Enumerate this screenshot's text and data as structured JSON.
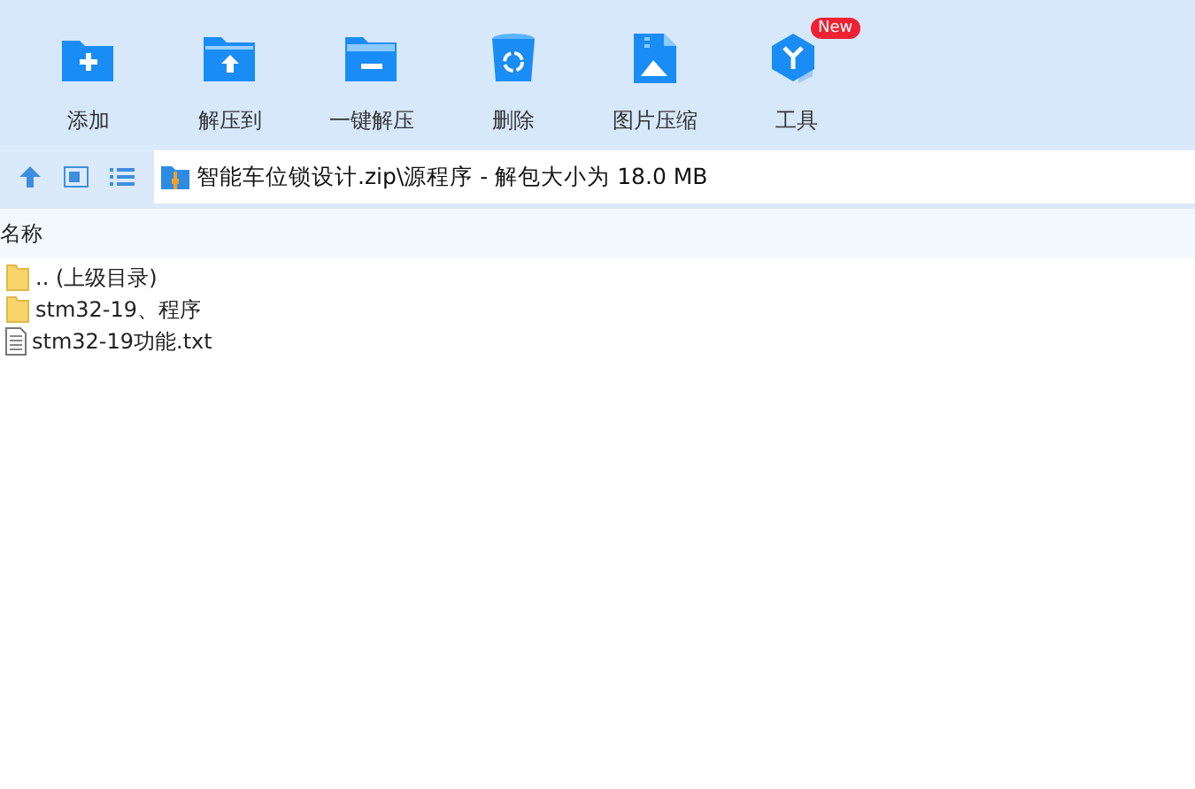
{
  "toolbar": [
    {
      "label": "添加",
      "kind": "add"
    },
    {
      "label": "解压到",
      "kind": "extract"
    },
    {
      "label": "一键解压",
      "kind": "oneclick"
    },
    {
      "label": "删除",
      "kind": "delete"
    },
    {
      "label": "图片压缩",
      "kind": "image"
    },
    {
      "label": "工具",
      "kind": "tools",
      "badge": "New"
    }
  ],
  "address": {
    "path": "智能车位锁设计.zip\\源程序 - 解包大小为 18.0 MB"
  },
  "list": {
    "columns": [
      "名称"
    ],
    "rows": [
      {
        "name": ".. (上级目录)",
        "kind": "folder",
        "selected": false
      },
      {
        "name": "stm32-19、程序",
        "kind": "folder",
        "selected": false
      },
      {
        "name": "stm32-19功能.txt",
        "kind": "file",
        "selected": false
      }
    ]
  }
}
